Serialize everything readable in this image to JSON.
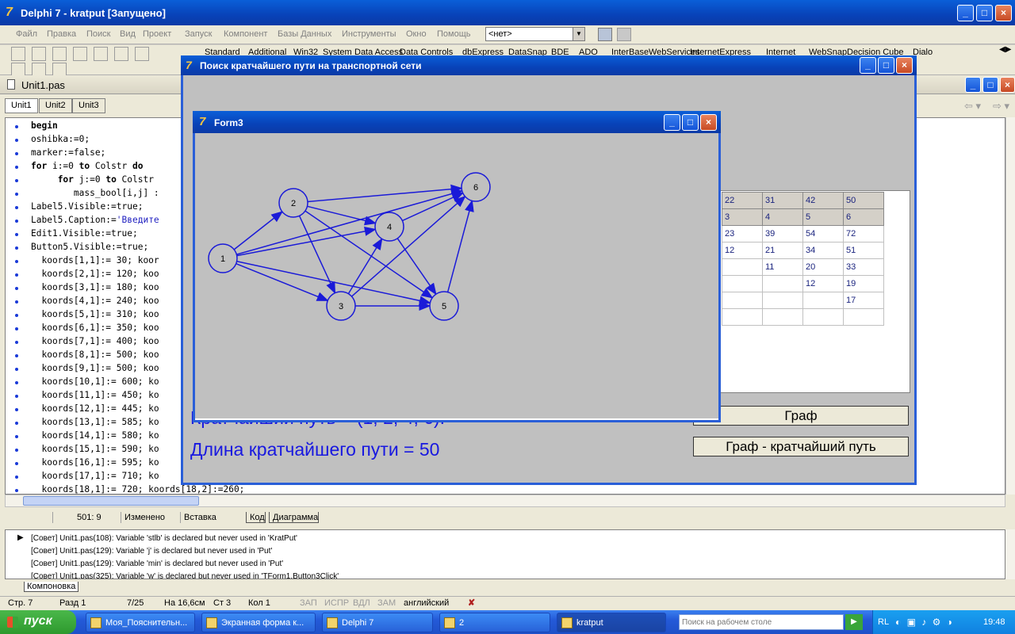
{
  "ide": {
    "title": "Delphi 7 - kratput [Запущено]",
    "menu": [
      "Файл",
      "Правка",
      "Поиск",
      "Вид",
      "Проект",
      "Запуск",
      "Компонент",
      "Базы Данных",
      "Инструменты",
      "Окно",
      "Помощь"
    ],
    "combo": "<нет>",
    "palette_tabs": [
      "Standard",
      "Additional",
      "Win32",
      "System",
      "Data Access",
      "Data Controls",
      "dbExpress",
      "DataSnap",
      "BDE",
      "ADO",
      "InterBase",
      "WebServices",
      "InternetExpress",
      "Internet",
      "WebSnap",
      "Decision Cube",
      "Dialo"
    ]
  },
  "editor": {
    "title": "Unit1.pas",
    "tabs": [
      "Unit1",
      "Unit2",
      "Unit3"
    ],
    "lines": [
      [
        [
          "kw",
          "begin"
        ]
      ],
      [
        [
          "n",
          "oshibka:=0;"
        ]
      ],
      [
        [
          "n",
          "marker:=false;"
        ]
      ],
      [
        [
          "kw",
          "for"
        ],
        [
          "n",
          " i:=0 "
        ],
        [
          "kw",
          "to"
        ],
        [
          "n",
          " Colstr "
        ],
        [
          "kw",
          "do"
        ]
      ],
      [
        [
          "n",
          "     "
        ],
        [
          "kw",
          "for"
        ],
        [
          "n",
          " j:=0 "
        ],
        [
          "kw",
          "to"
        ],
        [
          "n",
          " Colstr"
        ]
      ],
      [
        [
          "n",
          "        mass_bool[i,j] :"
        ]
      ],
      [
        [
          "n",
          "Label5.Visible:=true;"
        ]
      ],
      [
        [
          "n",
          "Label5.Caption:="
        ],
        [
          "s",
          "'Введите"
        ]
      ],
      [
        [
          "n",
          "Edit1.Visible:=true;"
        ]
      ],
      [
        [
          "n",
          "Button5.Visible:=true;"
        ]
      ],
      [
        [
          "n",
          "  koords[1,1]:= 30; koor"
        ]
      ],
      [
        [
          "n",
          "  koords[2,1]:= 120; koo"
        ]
      ],
      [
        [
          "n",
          "  koords[3,1]:= 180; koo"
        ]
      ],
      [
        [
          "n",
          "  koords[4,1]:= 240; koo"
        ]
      ],
      [
        [
          "n",
          "  koords[5,1]:= 310; koo"
        ]
      ],
      [
        [
          "n",
          "  koords[6,1]:= 350; koo"
        ]
      ],
      [
        [
          "n",
          "  koords[7,1]:= 400; koo"
        ]
      ],
      [
        [
          "n",
          "  koords[8,1]:= 500; koo"
        ]
      ],
      [
        [
          "n",
          "  koords[9,1]:= 500; koo"
        ]
      ],
      [
        [
          "n",
          "  koords[10,1]:= 600; ko"
        ]
      ],
      [
        [
          "n",
          "  koords[11,1]:= 450; ko"
        ]
      ],
      [
        [
          "n",
          "  koords[12,1]:= 445; ko"
        ]
      ],
      [
        [
          "n",
          "  koords[13,1]:= 585; ko"
        ]
      ],
      [
        [
          "n",
          "  koords[14,1]:= 580; ko"
        ]
      ],
      [
        [
          "n",
          "  koords[15,1]:= 590; ko"
        ]
      ],
      [
        [
          "n",
          "  koords[16,1]:= 595; ko"
        ]
      ],
      [
        [
          "n",
          "  koords[17,1]:= 710; ko"
        ]
      ],
      [
        [
          "n",
          "  koords[18,1]:= 720; koords[18,2]:=260;"
        ]
      ]
    ],
    "status": {
      "pos": "501:  9",
      "modified": "Изменено",
      "mode": "Вставка",
      "tab_code": "Код",
      "tab_diagram": "Диаграмма"
    }
  },
  "messages": {
    "items": [
      "[Совет] Unit1.pas(108): Variable 'stlb' is declared but never used in 'KratPut'",
      "[Совет] Unit1.pas(129): Variable 'j' is declared but never used in 'Put'",
      "[Совет] Unit1.pas(129): Variable 'min' is declared but never used in 'Put'",
      "[Совет] Unit1.pas(325): Variable 'w' is declared but never used in 'TForm1.Button3Click'"
    ],
    "tab": "Компоновка"
  },
  "word_status": {
    "page": "Стр. 7",
    "section": "Разд 1",
    "pages": "7/25",
    "at": "На 16,6см",
    "line": "Ст 3",
    "col": "Кол 1",
    "zap": "ЗАП",
    "ispr": "ИСПР",
    "vdl": "ВДЛ",
    "zam": "ЗАМ",
    "lang": "английский"
  },
  "main_form": {
    "title": "Поиск кратчайшего пути на транспортной сети",
    "path_label": "Кратчайший путь = (1, 2, 4, 6).",
    "length_label": "Длина кратчайшего пути = 50",
    "btn_graph": "Граф",
    "btn_graph_short": "Граф - кратчайший путь",
    "grid": [
      [
        "22",
        "31",
        "42",
        "50"
      ],
      [
        "3",
        "4",
        "5",
        "6"
      ],
      [
        "23",
        "39",
        "54",
        "72"
      ],
      [
        "12",
        "21",
        "34",
        "51"
      ],
      [
        "",
        "11",
        "20",
        "33"
      ],
      [
        "",
        "",
        "12",
        "19"
      ],
      [
        "",
        "",
        "",
        "17"
      ],
      [
        "",
        "",
        "",
        ""
      ]
    ]
  },
  "form3": {
    "title": "Form3",
    "nodes": [
      {
        "id": "1"
      },
      {
        "id": "2"
      },
      {
        "id": "3"
      },
      {
        "id": "4"
      },
      {
        "id": "5"
      },
      {
        "id": "6"
      }
    ],
    "edges": [
      [
        "1",
        "2"
      ],
      [
        "1",
        "3"
      ],
      [
        "1",
        "4"
      ],
      [
        "1",
        "5"
      ],
      [
        "1",
        "6"
      ],
      [
        "2",
        "3"
      ],
      [
        "2",
        "4"
      ],
      [
        "2",
        "5"
      ],
      [
        "2",
        "6"
      ],
      [
        "3",
        "4"
      ],
      [
        "3",
        "5"
      ],
      [
        "3",
        "6"
      ],
      [
        "4",
        "5"
      ],
      [
        "4",
        "6"
      ],
      [
        "5",
        "6"
      ]
    ]
  },
  "taskbar": {
    "start": "пуск",
    "items": [
      "Моя_Пояснительн...",
      "Экранная форма к...",
      "Delphi 7",
      "2",
      "kratput"
    ],
    "search_placeholder": "Поиск на рабочем столе",
    "lang": "RL",
    "clock": "19:48"
  }
}
